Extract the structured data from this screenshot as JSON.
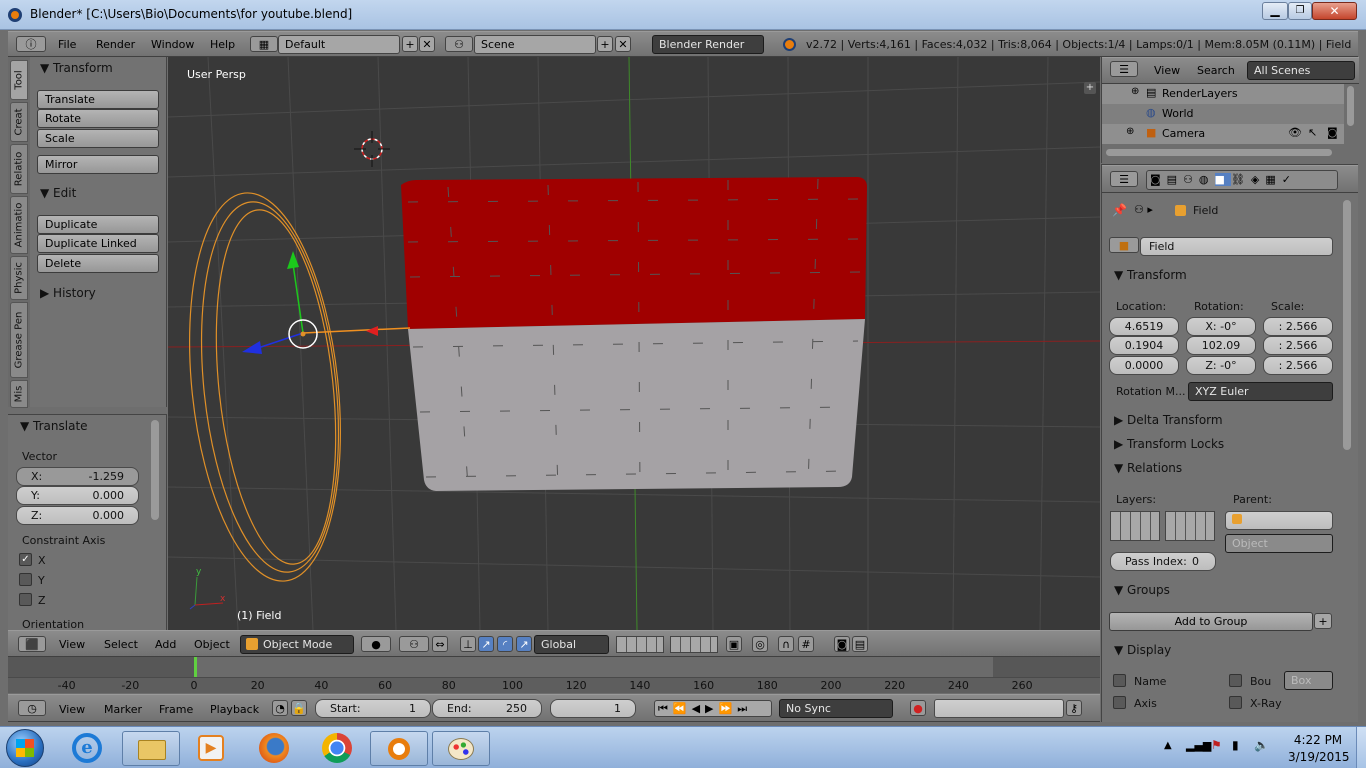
{
  "window": {
    "title": "Blender* [C:\\Users\\Bio\\Documents\\for youtube.blend]"
  },
  "info_header": {
    "menus": [
      "File",
      "Render",
      "Window",
      "Help"
    ],
    "layout": "Default",
    "scene": "Scene",
    "engine": "Blender Render",
    "stats": "v2.72 | Verts:4,161 | Faces:4,032 | Tris:8,064 | Objects:1/4 | Lamps:0/1 | Mem:8.05M (0.11M) | Field"
  },
  "tool_tabs": [
    "Tool",
    "Creat",
    "Relatio",
    "Animatio",
    "Physic",
    "Grease Pen",
    "Mis"
  ],
  "tool_panel": {
    "transform_title": "Transform",
    "translate": "Translate",
    "rotate": "Rotate",
    "scale": "Scale",
    "mirror": "Mirror",
    "edit_title": "Edit",
    "duplicate": "Duplicate",
    "duplicate_linked": "Duplicate Linked",
    "delete": "Delete",
    "history_title": "History"
  },
  "operator_panel": {
    "title": "Translate",
    "vector_label": "Vector",
    "x_label": "X:",
    "x": "-1.259",
    "y_label": "Y:",
    "y": "0.000",
    "z_label": "Z:",
    "z": "0.000",
    "constraint_label": "Constraint Axis",
    "cx": "X",
    "cy": "Y",
    "cz": "Z",
    "orientation_label": "Orientation"
  },
  "viewport": {
    "view_label": "User Persp",
    "object_label": "(1) Field",
    "axis_y": "y",
    "axis_x": "x"
  },
  "view3d_header": {
    "menus": [
      "View",
      "Select",
      "Add",
      "Object"
    ],
    "mode": "Object Mode",
    "orientation": "Global"
  },
  "timeline": {
    "ticks": [
      "-40",
      "-20",
      "0",
      "20",
      "40",
      "60",
      "80",
      "100",
      "120",
      "140",
      "160",
      "180",
      "200",
      "220",
      "240",
      "260"
    ],
    "menus": [
      "View",
      "Marker",
      "Frame",
      "Playback"
    ],
    "start_label": "Start:",
    "start": "1",
    "end_label": "End:",
    "end": "250",
    "current": "1",
    "sync": "No Sync"
  },
  "outliner": {
    "view": "View",
    "search": "Search",
    "filter": "All Scenes",
    "items": [
      "RenderLayers",
      "World",
      "Camera"
    ]
  },
  "properties": {
    "object_name": "Field",
    "name_field": "Field",
    "transform_title": "Transform",
    "location_label": "Location:",
    "rotation_label": "Rotation:",
    "scale_label": "Scale:",
    "loc": [
      "4.6519",
      "0.1904",
      "0.0000"
    ],
    "rot": [
      "X:   -0°",
      "102.09",
      "Z:   -0°"
    ],
    "scale": [
      ": 2.566",
      ": 2.566",
      ": 2.566"
    ],
    "rotation_mode_label": "Rotation M...",
    "rotation_mode": "XYZ Euler",
    "delta": "Delta Transform",
    "locks": "Transform Locks",
    "relations": "Relations",
    "layers_label": "Layers:",
    "parent_label": "Parent:",
    "parent_type": "Object",
    "pass_index_label": "Pass Index:",
    "pass_index": "0",
    "groups": "Groups",
    "add_to_group": "Add to Group",
    "display": "Display",
    "name_label": "Name",
    "axis_label": "Axis",
    "bounds_label": "Bou",
    "bounds_value": "Box",
    "xray_label": "X-Ray"
  },
  "taskbar": {
    "time": "4:22 PM",
    "date": "3/19/2015"
  }
}
